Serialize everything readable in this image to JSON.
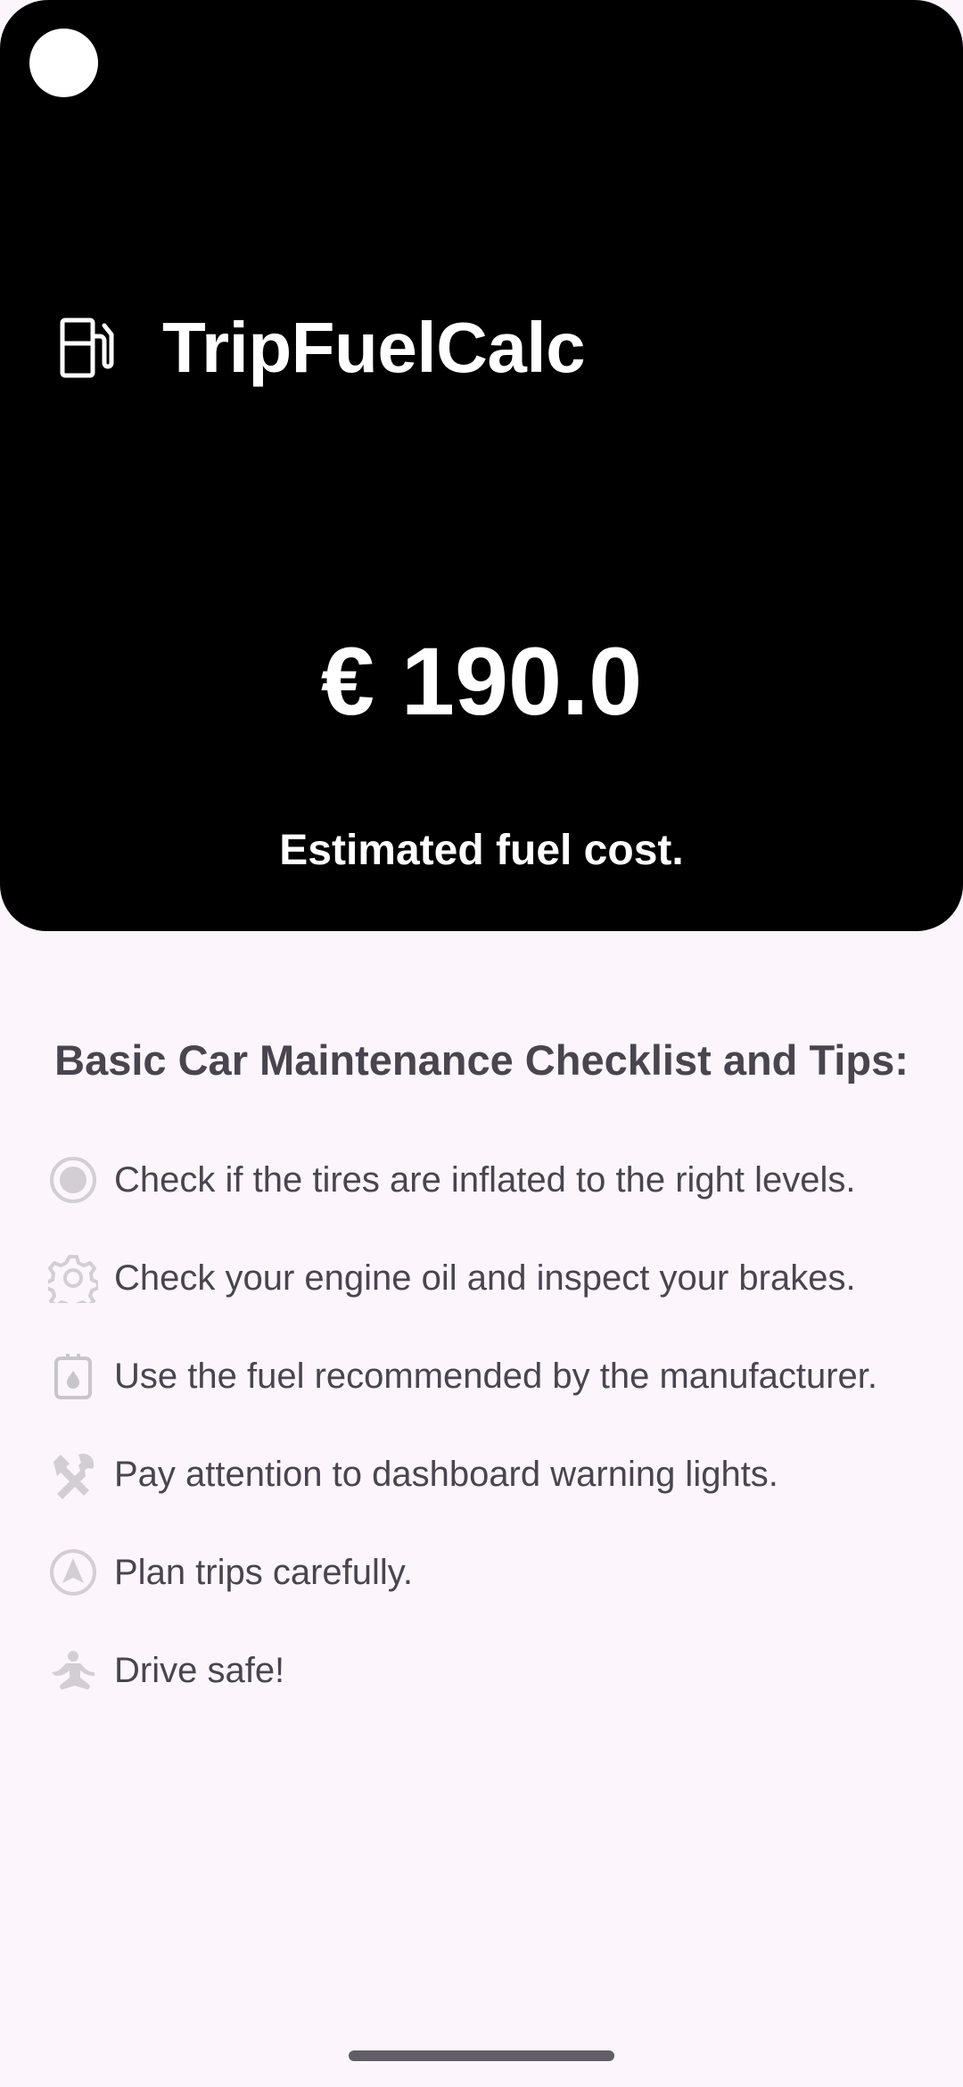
{
  "app": {
    "title": "TripFuelCalc",
    "icon": "fuel-pump-icon"
  },
  "result": {
    "amount": "€ 190.0",
    "caption": "Estimated fuel cost."
  },
  "tips": {
    "heading": "Basic Car Maintenance Checklist and Tips:",
    "items": [
      {
        "icon": "tire-icon",
        "text": "Check if the tires are inflated to the right levels."
      },
      {
        "icon": "gear-icon",
        "text": "Check your engine oil and inspect your brakes."
      },
      {
        "icon": "fuel-canister-icon",
        "text": "Use the fuel recommended by the manufacturer."
      },
      {
        "icon": "tools-icon",
        "text": "Pay attention to dashboard warning lights."
      },
      {
        "icon": "navigation-icon",
        "text": "Plan trips carefully."
      },
      {
        "icon": "meditation-icon",
        "text": "Drive safe!"
      }
    ]
  },
  "colors": {
    "hero_background": "#000000",
    "page_background": "#fcf5fc",
    "text_primary": "#49454f",
    "icon_muted": "#c9c5cc",
    "on_dark": "#ffffff"
  }
}
